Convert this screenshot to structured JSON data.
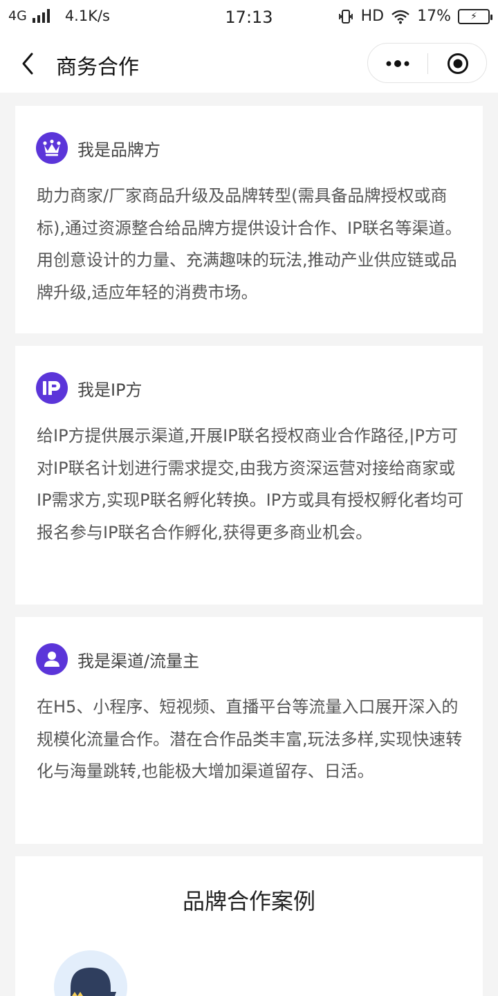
{
  "status_bar": {
    "network": "4G",
    "speed": "4.1K/s",
    "time": "17:13",
    "hd": "HD",
    "battery": "17%"
  },
  "nav": {
    "title": "商务合作",
    "icons": {
      "back": "chevron-left-icon",
      "more": "more-dots-icon",
      "close": "target-icon"
    }
  },
  "cards": [
    {
      "icon": "crown-icon",
      "title": "我是品牌方",
      "text": "助力商家/厂家商品升级及品牌转型(需具备品牌授权或商标),通过资源整合给品牌方提供设计合作、IP联名等渠道。用创意设计的力量、充满趣味的玩法,推动产业供应链或品牌升级,适应年轻的消费市场。"
    },
    {
      "icon": "ip-icon",
      "title": "我是IP方",
      "text": "给IP方提供展示渠道,开展IP联名授权商业合作路径,|P方可对IP联名计划进行需求提交,由我方资深运营对接给商家或IP需求方,实现P联名孵化转换。IP方或具有授权孵化者均可报名参与IP联名合作孵化,获得更多商业机会。"
    },
    {
      "icon": "user-icon",
      "title": "我是渠道/流量主",
      "text": "在H5、小程序、短视频、直播平台等流量入口展开深入的规模化流量合作。潜在合作品类丰富,玩法多样,实现快速转化与海量跳转,也能极大增加渠道留存、日活。"
    }
  ],
  "cases": {
    "title": "品牌合作案例"
  },
  "colors": {
    "accent": "#5b35d9",
    "background": "#f4f4f4"
  }
}
